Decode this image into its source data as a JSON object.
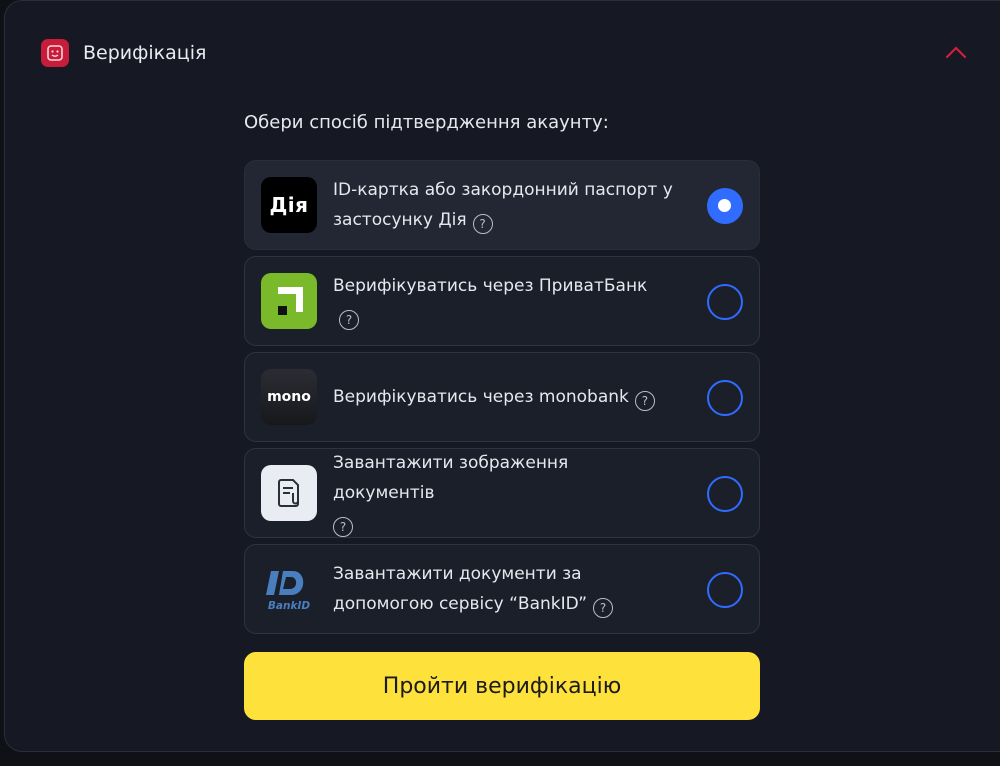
{
  "colors": {
    "background": "#0f1117",
    "panel": "#161923",
    "accent_red": "#c81d3a",
    "radio_blue": "#2f6cff",
    "button_yellow": "#ffe13b",
    "privat_green": "#7ab929"
  },
  "header": {
    "icon": "verification-badge-icon",
    "title": "Верифікація",
    "collapse_icon": "chevron-up-icon"
  },
  "prompt": "Обери спосіб підтвердження акаунту:",
  "options": [
    {
      "logo_text": "Дія",
      "text": "ID-картка або закордонний паспорт у застосунку Дія",
      "selected": true
    },
    {
      "logo_text": "",
      "text": "Верифікуватись через ПриватБанк",
      "selected": false
    },
    {
      "logo_text": "mono",
      "text": "Верифікуватись через monobank",
      "selected": false
    },
    {
      "logo_text": "",
      "text": "Завантажити зображення документів",
      "selected": false
    },
    {
      "logo_text": "BankID",
      "text": "Завантажити документи за допомогою сервісу “BankID”",
      "selected": false
    }
  ],
  "help_glyph": "?",
  "submit_label": "Пройти верифікацію"
}
